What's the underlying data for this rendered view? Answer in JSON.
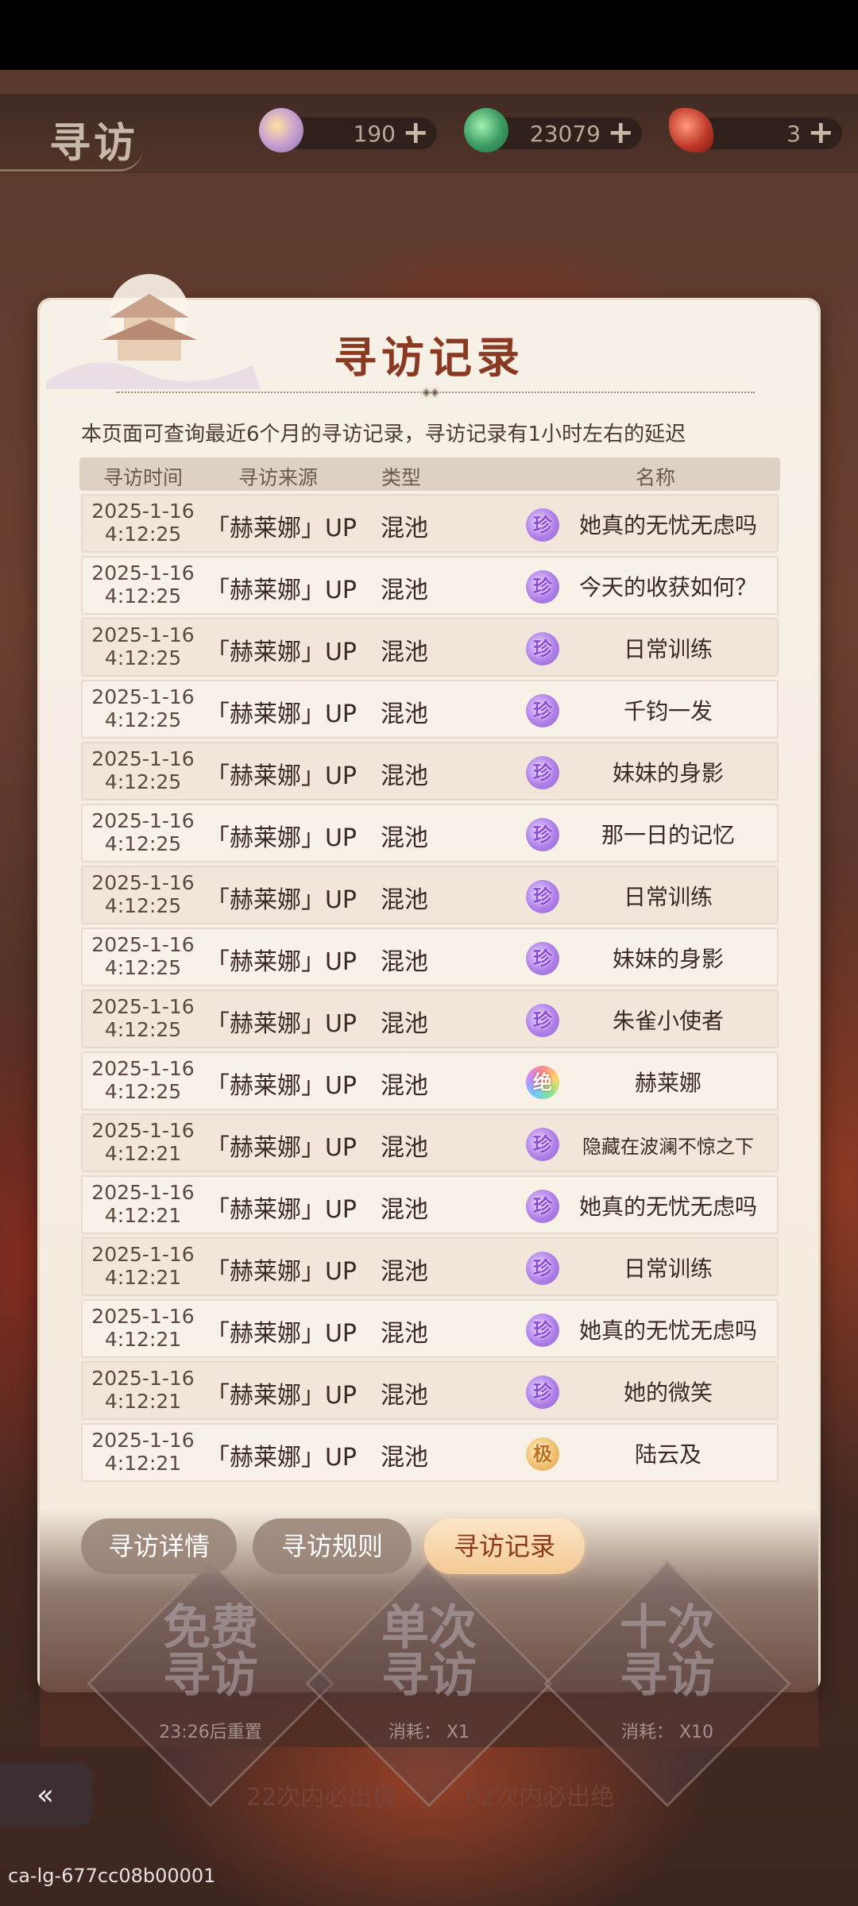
{
  "header": {
    "title": "寻访",
    "currencies": [
      {
        "icon": "jade-orb-icon",
        "value": "190"
      },
      {
        "icon": "green-token-icon",
        "value": "23079"
      },
      {
        "icon": "red-ticket-icon",
        "value": "3"
      }
    ],
    "plus": "+"
  },
  "dialog": {
    "title": "寻访记录",
    "notice": "本页面可查询最近6个月的寻访记录，寻访记录有1小时左右的延迟",
    "columns": [
      "寻访时间",
      "寻访来源",
      "类型",
      "名称"
    ],
    "rows": [
      {
        "date": "2025-1-16",
        "time": "4:12:25",
        "source": "「赫莱娜」UP",
        "type": "混池",
        "rarity": "珍",
        "name": "她真的无忧无虑吗"
      },
      {
        "date": "2025-1-16",
        "time": "4:12:25",
        "source": "「赫莱娜」UP",
        "type": "混池",
        "rarity": "珍",
        "name": "今天的收获如何？"
      },
      {
        "date": "2025-1-16",
        "time": "4:12:25",
        "source": "「赫莱娜」UP",
        "type": "混池",
        "rarity": "珍",
        "name": "日常训练"
      },
      {
        "date": "2025-1-16",
        "time": "4:12:25",
        "source": "「赫莱娜」UP",
        "type": "混池",
        "rarity": "珍",
        "name": "千钧一发"
      },
      {
        "date": "2025-1-16",
        "time": "4:12:25",
        "source": "「赫莱娜」UP",
        "type": "混池",
        "rarity": "珍",
        "name": "妹妹的身影"
      },
      {
        "date": "2025-1-16",
        "time": "4:12:25",
        "source": "「赫莱娜」UP",
        "type": "混池",
        "rarity": "珍",
        "name": "那一日的记忆"
      },
      {
        "date": "2025-1-16",
        "time": "4:12:25",
        "source": "「赫莱娜」UP",
        "type": "混池",
        "rarity": "珍",
        "name": "日常训练"
      },
      {
        "date": "2025-1-16",
        "time": "4:12:25",
        "source": "「赫莱娜」UP",
        "type": "混池",
        "rarity": "珍",
        "name": "妹妹的身影"
      },
      {
        "date": "2025-1-16",
        "time": "4:12:25",
        "source": "「赫莱娜」UP",
        "type": "混池",
        "rarity": "珍",
        "name": "朱雀小使者"
      },
      {
        "date": "2025-1-16",
        "time": "4:12:25",
        "source": "「赫莱娜」UP",
        "type": "混池",
        "rarity": "绝",
        "name": "赫莱娜"
      },
      {
        "date": "2025-1-16",
        "time": "4:12:21",
        "source": "「赫莱娜」UP",
        "type": "混池",
        "rarity": "珍",
        "name": "隐藏在波澜不惊之下"
      },
      {
        "date": "2025-1-16",
        "time": "4:12:21",
        "source": "「赫莱娜」UP",
        "type": "混池",
        "rarity": "珍",
        "name": "她真的无忧无虑吗"
      },
      {
        "date": "2025-1-16",
        "time": "4:12:21",
        "source": "「赫莱娜」UP",
        "type": "混池",
        "rarity": "珍",
        "name": "日常训练"
      },
      {
        "date": "2025-1-16",
        "time": "4:12:21",
        "source": "「赫莱娜」UP",
        "type": "混池",
        "rarity": "珍",
        "name": "她真的无忧无虑吗"
      },
      {
        "date": "2025-1-16",
        "time": "4:12:21",
        "source": "「赫莱娜」UP",
        "type": "混池",
        "rarity": "珍",
        "name": "她的微笑"
      },
      {
        "date": "2025-1-16",
        "time": "4:12:21",
        "source": "「赫莱娜」UP",
        "type": "混池",
        "rarity": "极",
        "name": "陆云及"
      }
    ]
  },
  "tabs": [
    {
      "label": "寻访详情",
      "active": false
    },
    {
      "label": "寻访规则",
      "active": false
    },
    {
      "label": "寻访记录",
      "active": true
    }
  ],
  "actions": {
    "free": {
      "title_line1": "免费",
      "title_line2": "寻访",
      "sub": "23:26后重置"
    },
    "single": {
      "title_line1": "单次",
      "title_line2": "寻访",
      "sub": "消耗： X1"
    },
    "ten": {
      "title_line1": "十次",
      "title_line2": "寻访",
      "sub": "消耗： X10"
    }
  },
  "guarantee": {
    "left_count": "22",
    "left_text": "次内必出",
    "left_badge": "极",
    "right_count": "62",
    "right_text": "次内必出",
    "right_badge": "绝"
  },
  "watermark": "ca-lg-677cc08b00001"
}
